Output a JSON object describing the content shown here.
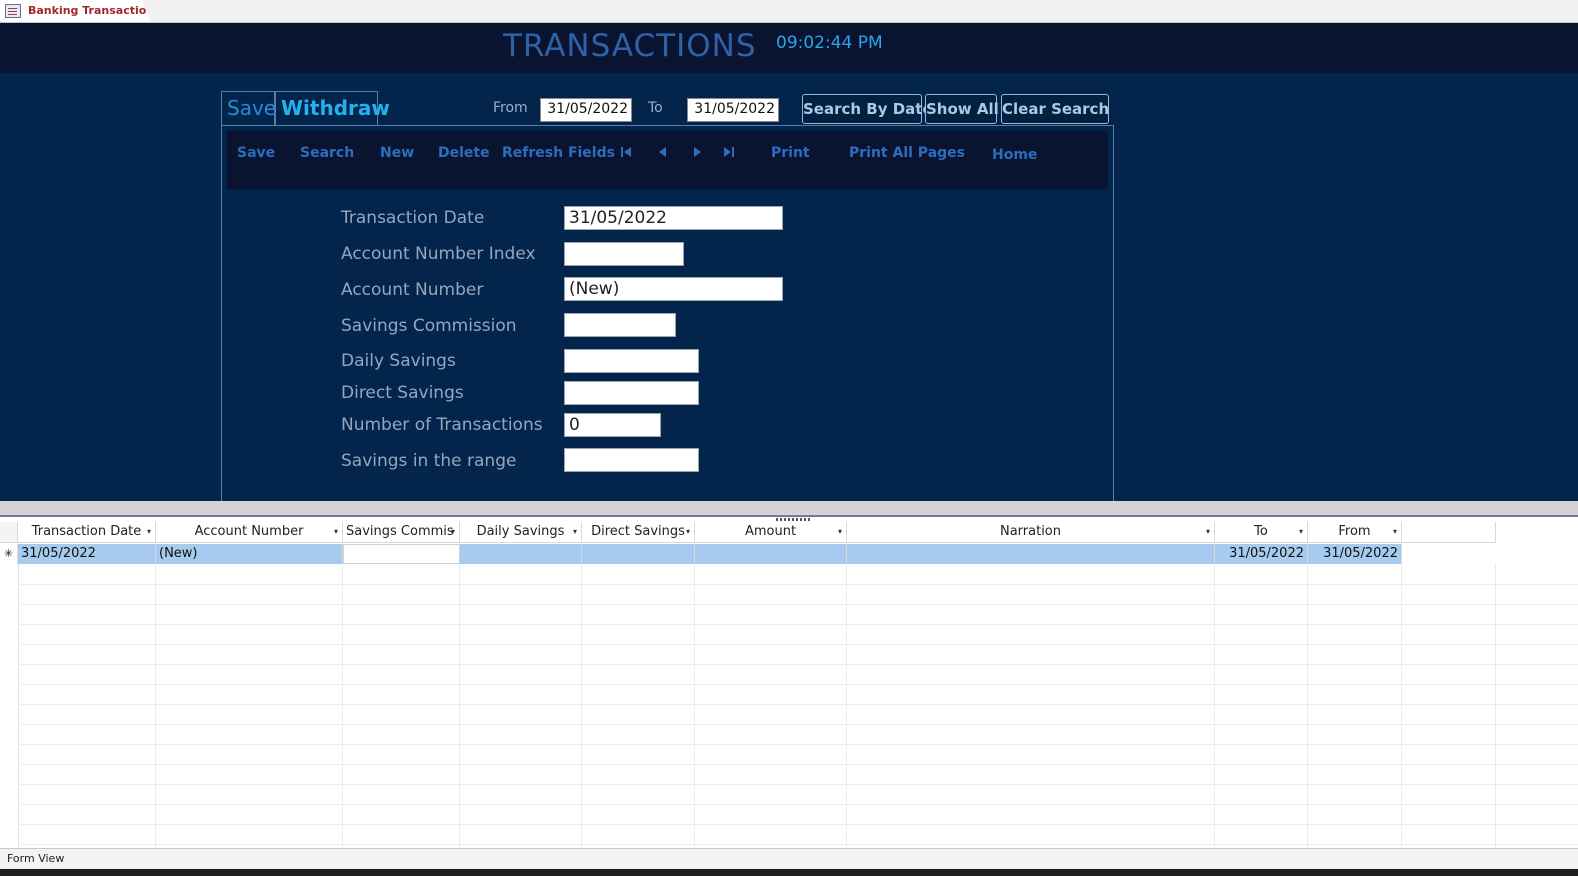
{
  "document_tab": {
    "label": "Banking Transactions"
  },
  "header": {
    "title": "TRANSACTIONS",
    "clock": "09:02:44 PM"
  },
  "tabs": [
    {
      "label": "Save"
    },
    {
      "label": "Withdraw"
    }
  ],
  "search": {
    "from_label": "From",
    "from_value": "31/05/2022",
    "to_label": "To",
    "to_value": "31/05/2022",
    "search_by_date_label": "Search By Date",
    "show_all_label": "Show All",
    "clear_search_label": "Clear Search"
  },
  "toolbar": {
    "save": "Save",
    "search": "Search",
    "new": "New",
    "delete": "Delete",
    "refresh": "Refresh Fields",
    "print": "Print",
    "print_all": "Print All Pages",
    "home": "Home",
    "nav_icons": [
      "first-record-icon",
      "previous-record-icon",
      "next-record-icon",
      "last-record-icon"
    ]
  },
  "form": {
    "fields": [
      {
        "label": "Transaction Date",
        "value": "31/05/2022"
      },
      {
        "label": "Account Number Index",
        "value": ""
      },
      {
        "label": "Account Number",
        "value": "(New)"
      },
      {
        "label": "Savings Commission",
        "value": ""
      },
      {
        "label": "Daily Savings",
        "value": ""
      },
      {
        "label": "Direct Savings",
        "value": ""
      },
      {
        "label": "Number of Transactions",
        "value": "0"
      },
      {
        "label": "Savings in the range",
        "value": ""
      }
    ]
  },
  "datasheet": {
    "columns": [
      "Transaction Date",
      "Account Number",
      "Savings Commis",
      "Daily Savings",
      "Direct Savings",
      "Amount",
      "Narration",
      "To",
      "From"
    ],
    "new_row_marker": "✳",
    "rows": [
      [
        "31/05/2022",
        "(New)",
        "",
        "",
        "",
        "",
        "",
        "31/05/2022",
        "31/05/2022"
      ]
    ]
  },
  "status_bar": {
    "text": "Form View"
  },
  "colors": {
    "header_bg": "#0a1430",
    "form_bg": "#03254c",
    "title": "#2d62a5",
    "clock": "#2aa6e8",
    "toolbar_text": "#2d6dbe",
    "row_highlight": "#a6cbef"
  }
}
